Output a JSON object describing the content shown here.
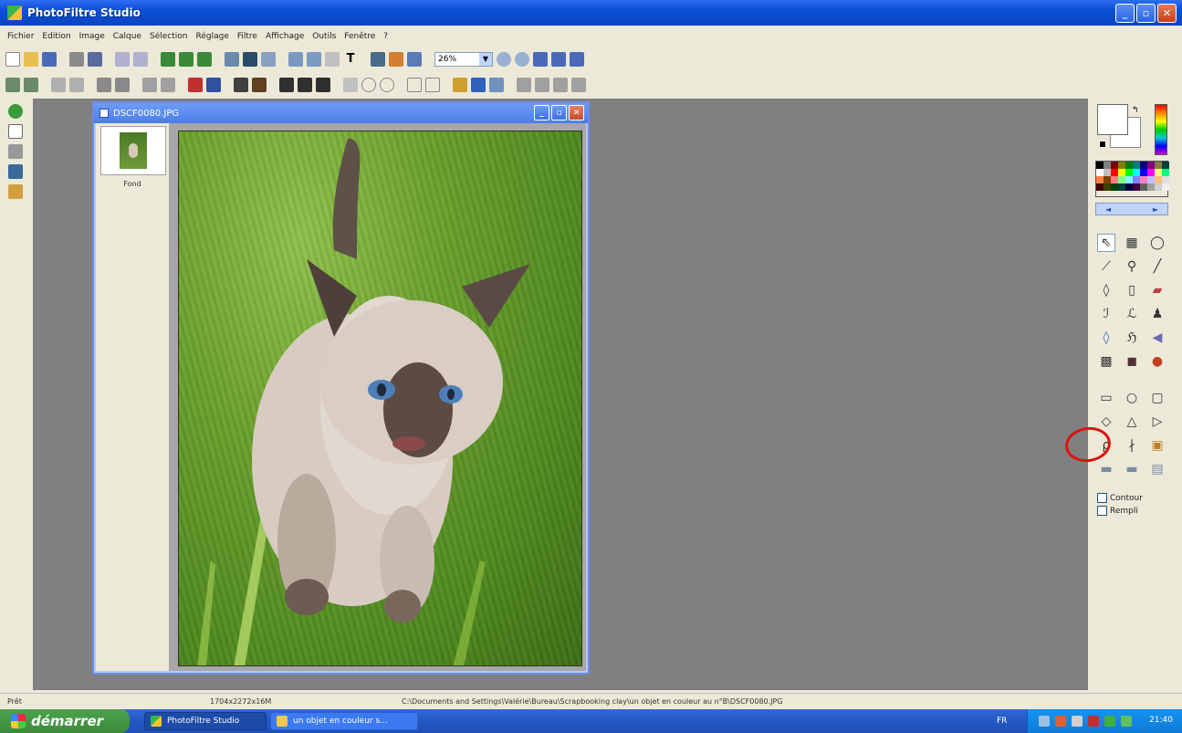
{
  "window": {
    "title": "PhotoFiltre Studio"
  },
  "menu": [
    "Fichier",
    "Edition",
    "Image",
    "Calque",
    "Sélection",
    "Réglage",
    "Filtre",
    "Affichage",
    "Outils",
    "Fenêtre",
    "?"
  ],
  "toolbar": {
    "zoom_value": "26%"
  },
  "document": {
    "title": "DSCF0080.JPG",
    "layer_label": "Fond"
  },
  "tool_options": {
    "contour_label": "Contour",
    "fill_label": "Rempli"
  },
  "status": {
    "state": "Prêt",
    "dimensions": "1704x2272x16M",
    "path": "C:\\Documents and Settings\\Valérie\\Bureau\\Scrapbooking clay\\un objet en couleur au n°B\\DSCF0080.JPG"
  },
  "taskbar": {
    "start_label": "démarrer",
    "tasks": [
      "PhotoFiltre Studio",
      "un objet en couleur s..."
    ],
    "lang": "FR",
    "clock": "21:40"
  },
  "colors": {
    "accent": "#0a4fd6",
    "workspace": "#808080",
    "highlight_circle": "#e01010"
  }
}
